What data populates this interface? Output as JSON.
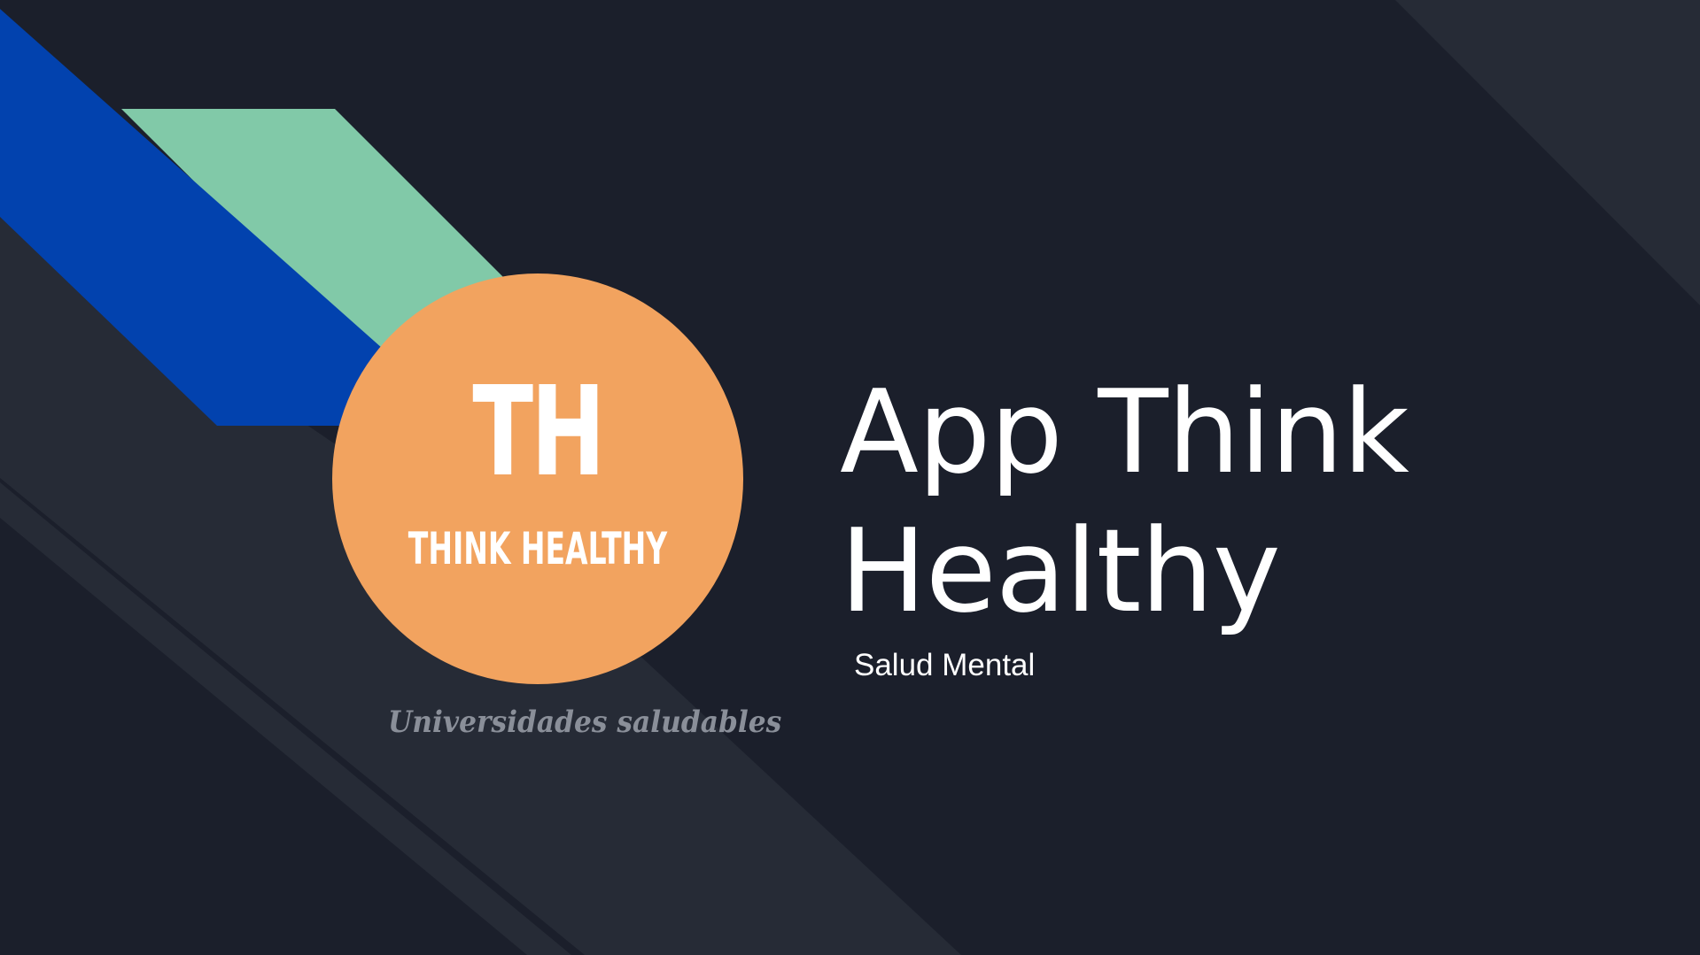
{
  "slide": {
    "title": "App Think Healthy",
    "subtitle": "Salud Mental"
  },
  "logo": {
    "monogram": "TH",
    "name": "THINK HEALTHY",
    "tagline": "Universidades saludables"
  },
  "colors": {
    "background": "#1b1f2b",
    "stripe_blue": "#0242ae",
    "stripe_green": "#81c9a8",
    "stripe_dark": "#262b36",
    "logo_circle": "#f2a35f",
    "text": "#ffffff"
  }
}
